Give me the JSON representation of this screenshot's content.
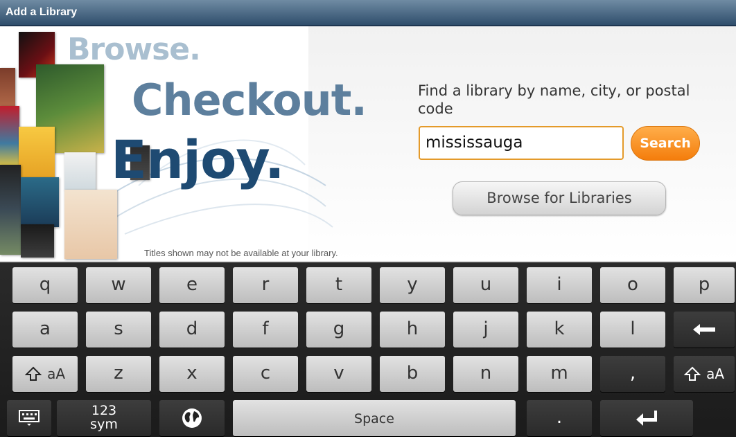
{
  "window": {
    "title": "Add a Library"
  },
  "promo": {
    "line1": "Browse.",
    "line2": "Checkout.",
    "line3": "Enjoy.",
    "disclaimer": "Titles shown may not be available at your library."
  },
  "search": {
    "label": "Find a library by name, city, or postal code",
    "value": "mississauga",
    "button_label": "Search",
    "browse_label": "Browse for Libraries"
  },
  "keyboard": {
    "row1": [
      "q",
      "w",
      "e",
      "r",
      "t",
      "y",
      "u",
      "i",
      "o",
      "p"
    ],
    "row2": [
      "a",
      "s",
      "d",
      "f",
      "g",
      "h",
      "j",
      "k",
      "l"
    ],
    "row3": [
      "z",
      "x",
      "c",
      "v",
      "b",
      "n",
      "m",
      ","
    ],
    "shift_label": "aA",
    "sym_line1": "123",
    "sym_line2": "sym",
    "space_label": "Space",
    "period_label": "."
  },
  "colors": {
    "accent": "#f47d0c",
    "titlebar": "#2f4e6c",
    "promo_dark": "#1e4a72"
  }
}
